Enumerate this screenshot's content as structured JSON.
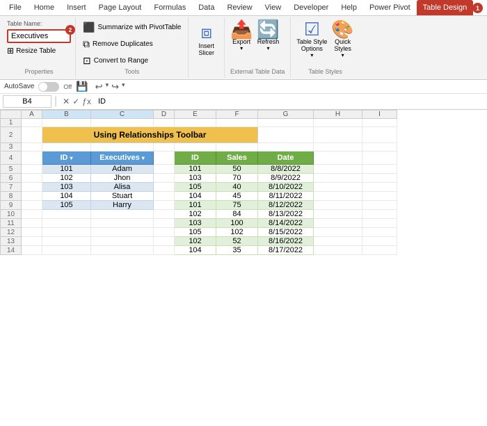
{
  "tabs": [
    "File",
    "Home",
    "Insert",
    "Page Layout",
    "Formulas",
    "Data",
    "Review",
    "View",
    "Developer",
    "Help",
    "Power Pivot",
    "Table Design"
  ],
  "active_tab": "Table Design",
  "ribbon": {
    "properties_group_label": "Properties",
    "tools_group_label": "Tools",
    "external_data_group_label": "External Table Data",
    "table_styles_group_label": "Table Styles",
    "table_name_label": "Table Name:",
    "table_name_value": "Executives",
    "table_name_badge": "2",
    "resize_table_label": "Resize Table",
    "summarize_pivot": "Summarize with PivotTable",
    "remove_duplicates": "Remove Duplicates",
    "remove_duplicates_badge": "",
    "convert_to_range": "Convert to Range",
    "insert_slicer_label": "Insert\nSlicer",
    "export_label": "Export",
    "refresh_label": "Refresh",
    "table_style_options_label": "Table Style\nOptions",
    "quick_styles_label": "Quick\nStyles",
    "badge1": "1"
  },
  "autosave": {
    "label": "AutoSave",
    "state": "Off"
  },
  "formula_bar": {
    "cell_ref": "B4",
    "formula": "ID"
  },
  "spreadsheet": {
    "col_headers": [
      "",
      "A",
      "B",
      "C",
      "D",
      "E",
      "F",
      "G",
      "H",
      "I"
    ],
    "title_text": "Using Relationships Toolbar",
    "table1": {
      "headers": [
        "ID",
        "Executives"
      ],
      "rows": [
        [
          "101",
          "Adam"
        ],
        [
          "102",
          "Jhon"
        ],
        [
          "103",
          "Alisa"
        ],
        [
          "104",
          "Stuart"
        ],
        [
          "105",
          "Harry"
        ]
      ]
    },
    "table2": {
      "headers": [
        "ID",
        "Sales",
        "Date"
      ],
      "rows": [
        [
          "101",
          "50",
          "8/8/2022"
        ],
        [
          "103",
          "70",
          "8/9/2022"
        ],
        [
          "105",
          "40",
          "8/10/2022"
        ],
        [
          "104",
          "45",
          "8/11/2022"
        ],
        [
          "101",
          "75",
          "8/12/2022"
        ],
        [
          "102",
          "84",
          "8/13/2022"
        ],
        [
          "103",
          "100",
          "8/14/2022"
        ],
        [
          "105",
          "102",
          "8/15/2022"
        ],
        [
          "102",
          "52",
          "8/16/2022"
        ],
        [
          "104",
          "35",
          "8/17/2022"
        ]
      ]
    }
  }
}
